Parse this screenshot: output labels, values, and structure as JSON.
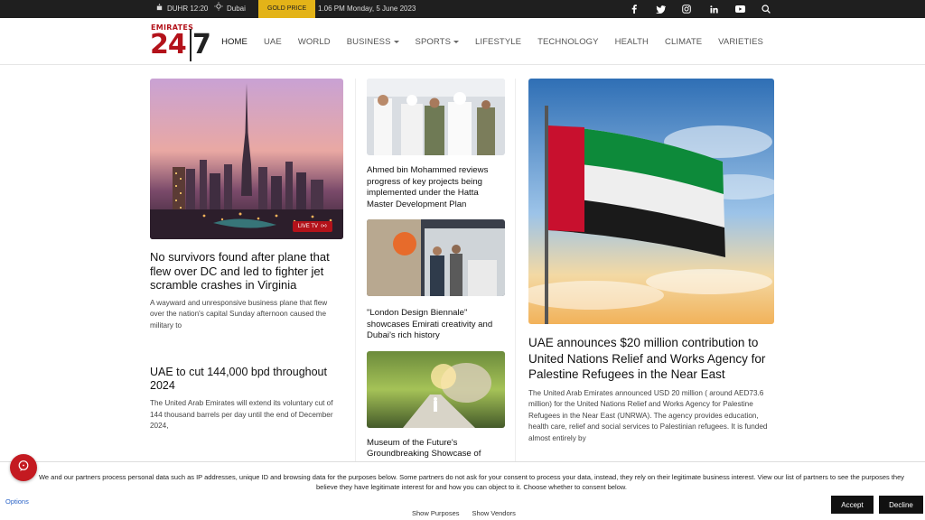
{
  "topbar": {
    "prayer": "DUHR 12:20",
    "city": "Dubai",
    "gold_label": "GOLD PRICE",
    "datetime": "1.06 PM Monday, 5 June 2023",
    "social_icons": [
      "facebook-icon",
      "twitter-icon",
      "instagram-icon",
      "linkedin-icon",
      "youtube-icon",
      "search-icon"
    ]
  },
  "logo": {
    "top": "EMIRATES",
    "num": "24",
    "seven": "7"
  },
  "nav": {
    "items": [
      {
        "label": "HOME"
      },
      {
        "label": "UAE"
      },
      {
        "label": "WORLD"
      },
      {
        "label": "BUSINESS"
      },
      {
        "label": "SPORTS"
      },
      {
        "label": "LIFESTYLE"
      },
      {
        "label": "TECHNOLOGY"
      },
      {
        "label": "HEALTH"
      },
      {
        "label": "CLIMATE"
      },
      {
        "label": "VARIETIES"
      }
    ]
  },
  "articles": {
    "lead": {
      "title": "No survivors found after plane that flew over DC and led to fighter jet scramble crashes in Virginia",
      "excerpt": "A wayward and unresponsive business plane that flew over the nation's capital Sunday afternoon caused the military to",
      "badge": "LIVE TV"
    },
    "second": {
      "title": "UAE to cut 144,000 bpd throughout 2024",
      "excerpt": "The United Arab Emirates will extend its voluntary cut of 144 thousand barrels per day until the end of December 2024,"
    },
    "mid1": {
      "title": "Ahmed bin Mohammed reviews progress of key projects being implemented under the Hatta Master Development Plan"
    },
    "mid2": {
      "title": "\"London Design Biennale\" showcases Emirati creativity and Dubai's rich history"
    },
    "mid3": {
      "title": "Museum of the Future's Groundbreaking Showcase of"
    },
    "feature": {
      "title": "UAE announces $20 million contribution to United Nations Relief and Works Agency for Palestine Refugees in the Near East",
      "excerpt": "The United Arab Emirates announced USD 20 million ( around AED73.6 million) for the United Nations Relief and Works Agency for Palestine Refugees in the Near East (UNRWA). The agency provides education, health care, relief and social services to Palestinian refugees. It is funded almost entirely by"
    }
  },
  "cookie": {
    "text": "We and our partners process personal data such as IP addresses, unique ID and browsing data for the purposes below. Some partners do not ask for your consent to process your data, instead, they rely on their legitimate business interest. View our list of partners to see the purposes they believe they have legitimate interest for and how you can object to it. Choose whether to consent below.",
    "options": "Options",
    "show_purposes": "Show Purposes",
    "show_vendors": "Show Vendors",
    "accept": "Accept",
    "decline": "Decline"
  },
  "colors": {
    "brand_red": "#b3121a",
    "gold": "#e3b318",
    "topbar": "#1f1f1f"
  }
}
